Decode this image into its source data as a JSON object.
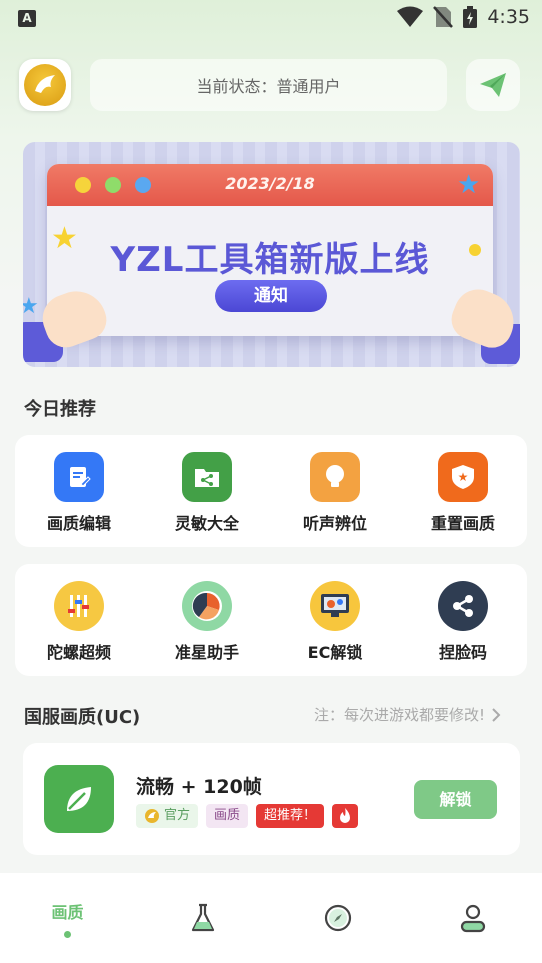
{
  "status_bar": {
    "time": "4:35",
    "left_icon_letter": "A"
  },
  "header": {
    "status_text": "当前状态：普通用户"
  },
  "banner": {
    "date": "2023/2/18",
    "title": "YZL工具箱新版上线",
    "button": "通知"
  },
  "recommend": {
    "title": "今日推荐",
    "row1": [
      {
        "label": "画质编辑",
        "icon": "edit-doc-icon",
        "color": "#3478f6"
      },
      {
        "label": "灵敏大全",
        "icon": "share-folder-icon",
        "color": "#43a047"
      },
      {
        "label": "听声辨位",
        "icon": "bulb-icon",
        "color": "#f3a241"
      },
      {
        "label": "重置画质",
        "icon": "shield-star-icon",
        "color": "#f06a1c"
      }
    ],
    "row2": [
      {
        "label": "陀螺超频",
        "icon": "sliders-icon",
        "color": "#f6c842"
      },
      {
        "label": "准星助手",
        "icon": "pie-crosshair-icon",
        "color": "#8fd8a4"
      },
      {
        "label": "EC解锁",
        "icon": "monitor-gear-icon",
        "color": "#f7c63d"
      },
      {
        "label": "捏脸码",
        "icon": "share-nodes-icon",
        "color": "#2f3d52"
      }
    ]
  },
  "quality": {
    "title": "国服画质(UC)",
    "note": "注：每次进游戏都要修改!",
    "mode_title": "流畅 + 120帧",
    "tags": {
      "official": "官方",
      "quality": "画质",
      "hot": "超推荐！"
    },
    "unlock": "解锁"
  },
  "bottom_nav": {
    "tab1": "画质"
  },
  "colors": {
    "accent": "#6cc274",
    "unlock": "#7fc987",
    "hot_red": "#e53935"
  }
}
